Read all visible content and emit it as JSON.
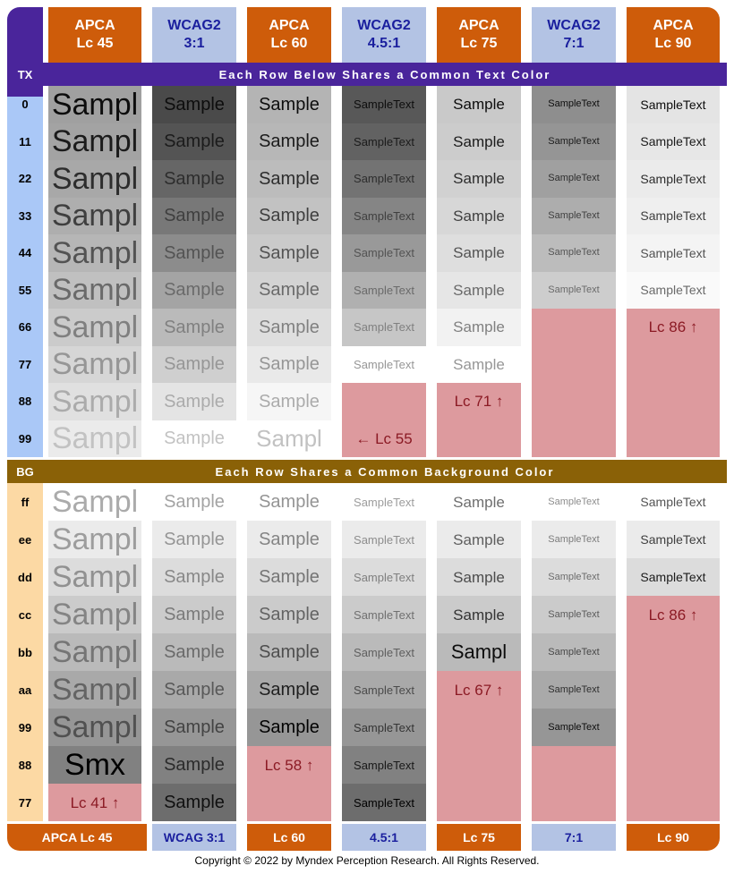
{
  "meta": {
    "copyright": "Copyright © 2022 by Myndex Perception Research. All Rights Reserved."
  },
  "colors": {
    "apca_chip": "#ce5c0a",
    "wcag_chip": "#b3c3e4",
    "apca_text": "#ffffff",
    "wcag_text": "#1a1f9e",
    "tx_bar": "#4a259b",
    "bg_bar": "#8a6107",
    "tx_label_cell": "#aac8f7",
    "bg_label_cell": "#fcd9a4",
    "fail_bg": "#dd9a9e",
    "fail_text": "#8b1a24"
  },
  "header": {
    "corner_tag": "TX",
    "columns": [
      {
        "std": "APCA",
        "level": "Lc 45",
        "kind": "apca"
      },
      {
        "std": "WCAG2",
        "level": "3:1",
        "kind": "wcag"
      },
      {
        "std": "APCA",
        "level": "Lc 60",
        "kind": "apca"
      },
      {
        "std": "WCAG2",
        "level": "4.5:1",
        "kind": "wcag"
      },
      {
        "std": "APCA",
        "level": "Lc 75",
        "kind": "apca"
      },
      {
        "std": "WCAG2",
        "level": "7:1",
        "kind": "wcag"
      },
      {
        "std": "APCA",
        "level": "Lc 90",
        "kind": "apca"
      }
    ]
  },
  "tx_section": {
    "tag": "TX",
    "title": "Each Row Below Shares a Common Text Color",
    "rows": [
      {
        "label": "0",
        "text": "#0d0d0d",
        "cells": [
          {
            "t": "Sampl",
            "bg": "#a0a0a0",
            "fs": 34
          },
          {
            "t": "Sample",
            "bg": "#4a4a4a",
            "fs": 20
          },
          {
            "t": "Sample",
            "bg": "#b4b4b4",
            "fs": 20
          },
          {
            "t": "SampleText",
            "bg": "#585858",
            "fs": 13
          },
          {
            "t": "Sample",
            "bg": "#c9c9c9",
            "fs": 17
          },
          {
            "t": "SampleText",
            "bg": "#8e8e8e",
            "fs": 11
          },
          {
            "t": "SampleText",
            "bg": "#e4e4e4",
            "fs": 14
          }
        ]
      },
      {
        "label": "11",
        "text": "#1b1b1b",
        "cells": [
          {
            "t": "Sampl",
            "bg": "#a3a3a3",
            "fs": 34
          },
          {
            "t": "Sample",
            "bg": "#545454",
            "fs": 20
          },
          {
            "t": "Sample",
            "bg": "#b7b7b7",
            "fs": 20
          },
          {
            "t": "SampleText",
            "bg": "#626262",
            "fs": 13
          },
          {
            "t": "Sample",
            "bg": "#cccccc",
            "fs": 17
          },
          {
            "t": "SampleText",
            "bg": "#959595",
            "fs": 11
          },
          {
            "t": "SampleText",
            "bg": "#e7e7e7",
            "fs": 14
          }
        ]
      },
      {
        "label": "22",
        "text": "#2d2d2d",
        "cells": [
          {
            "t": "Sampl",
            "bg": "#a8a8a8",
            "fs": 34
          },
          {
            "t": "Sample",
            "bg": "#666666",
            "fs": 20
          },
          {
            "t": "Sample",
            "bg": "#bcbcbc",
            "fs": 20
          },
          {
            "t": "SampleText",
            "bg": "#737373",
            "fs": 13
          },
          {
            "t": "Sample",
            "bg": "#d1d1d1",
            "fs": 17
          },
          {
            "t": "SampleText",
            "bg": "#a0a0a0",
            "fs": 11
          },
          {
            "t": "SampleText",
            "bg": "#ebebeb",
            "fs": 14
          }
        ]
      },
      {
        "label": "33",
        "text": "#3f3f3f",
        "cells": [
          {
            "t": "Sampl",
            "bg": "#aeaeae",
            "fs": 34
          },
          {
            "t": "Sample",
            "bg": "#787878",
            "fs": 20
          },
          {
            "t": "Sample",
            "bg": "#c2c2c2",
            "fs": 20
          },
          {
            "t": "SampleText",
            "bg": "#858585",
            "fs": 13
          },
          {
            "t": "Sample",
            "bg": "#d7d7d7",
            "fs": 17
          },
          {
            "t": "SampleText",
            "bg": "#adadad",
            "fs": 11
          },
          {
            "t": "SampleText",
            "bg": "#efefef",
            "fs": 14
          }
        ]
      },
      {
        "label": "44",
        "text": "#535353",
        "cells": [
          {
            "t": "Sampl",
            "bg": "#b6b6b6",
            "fs": 34
          },
          {
            "t": "Sample",
            "bg": "#8c8c8c",
            "fs": 20
          },
          {
            "t": "Sample",
            "bg": "#cacaca",
            "fs": 20
          },
          {
            "t": "SampleText",
            "bg": "#999999",
            "fs": 13
          },
          {
            "t": "Sample",
            "bg": "#dedede",
            "fs": 17
          },
          {
            "t": "SampleText",
            "bg": "#bcbcbc",
            "fs": 11
          },
          {
            "t": "SampleText",
            "bg": "#f4f4f4",
            "fs": 14
          }
        ]
      },
      {
        "label": "55",
        "text": "#6a6a6a",
        "cells": [
          {
            "t": "Sampl",
            "bg": "#c0c0c0",
            "fs": 34
          },
          {
            "t": "Sample",
            "bg": "#a4a4a4",
            "fs": 20
          },
          {
            "t": "Sample",
            "bg": "#d3d3d3",
            "fs": 20
          },
          {
            "t": "SampleText",
            "bg": "#b0b0b0",
            "fs": 13
          },
          {
            "t": "Sample",
            "bg": "#e6e6e6",
            "fs": 17
          },
          {
            "t": "SampleText",
            "bg": "#cdcdcd",
            "fs": 11
          },
          {
            "t": "SampleText",
            "bg": "#fafafa",
            "fs": 14
          }
        ]
      },
      {
        "label": "66",
        "text": "#808080",
        "cells": [
          {
            "t": "Sampl",
            "bg": "#cbcbcb",
            "fs": 34
          },
          {
            "t": "Sample",
            "bg": "#bababa",
            "fs": 20
          },
          {
            "t": "Sample",
            "bg": "#dedede",
            "fs": 20
          },
          {
            "t": "SampleText",
            "bg": "#c6c6c6",
            "fs": 13
          },
          {
            "t": "Sample",
            "bg": "#f2f2f2",
            "fs": 17
          },
          {
            "t": "",
            "bg": "#dd9a9e",
            "fs": 17,
            "fail": true
          },
          {
            "t": "Lc 86 ↑",
            "bg": "#dd9a9e",
            "fs": 17,
            "fail": true
          }
        ]
      },
      {
        "label": "77",
        "text": "#969696",
        "cells": [
          {
            "t": "Sampl",
            "bg": "#d6d6d6",
            "fs": 34
          },
          {
            "t": "Sample",
            "bg": "#cfcfcf",
            "fs": 20
          },
          {
            "t": "Sample",
            "bg": "#e9e9e9",
            "fs": 20
          },
          {
            "t": "SampleText",
            "bg": "#ffffff",
            "fs": 13
          },
          {
            "t": "Sample",
            "bg": "#ffffff",
            "fs": 17
          },
          {
            "t": "",
            "bg": "#dd9a9e",
            "fs": 17,
            "fail": true
          },
          {
            "t": "",
            "bg": "#dd9a9e",
            "fs": 17,
            "fail": true
          }
        ]
      },
      {
        "label": "88",
        "text": "#ababab",
        "cells": [
          {
            "t": "Sampl",
            "bg": "#e0e0e0",
            "fs": 34
          },
          {
            "t": "Sample",
            "bg": "#e4e4e4",
            "fs": 20
          },
          {
            "t": "Sample",
            "bg": "#f6f6f6",
            "fs": 20
          },
          {
            "t": "",
            "bg": "#dd9a9e",
            "fs": 17,
            "fail": true
          },
          {
            "t": "Lc 71 ↑",
            "bg": "#dd9a9e",
            "fs": 17,
            "fail": true
          },
          {
            "t": "",
            "bg": "#dd9a9e",
            "fs": 17,
            "fail": true
          },
          {
            "t": "",
            "bg": "#dd9a9e",
            "fs": 17,
            "fail": true
          }
        ]
      },
      {
        "label": "99",
        "text": "#c2c2c2",
        "cells": [
          {
            "t": "Sampl",
            "bg": "#ebebeb",
            "fs": 34
          },
          {
            "t": "Sample",
            "bg": "#ffffff",
            "fs": 20
          },
          {
            "t": "Sampl",
            "bg": "#ffffff",
            "fs": 26
          },
          {
            "t": "← Lc 55",
            "bg": "#dd9a9e",
            "fs": 17,
            "fail": true
          },
          {
            "t": "",
            "bg": "#dd9a9e",
            "fs": 17,
            "fail": true
          },
          {
            "t": "",
            "bg": "#dd9a9e",
            "fs": 17,
            "fail": true
          },
          {
            "t": "",
            "bg": "#dd9a9e",
            "fs": 17,
            "fail": true
          }
        ]
      }
    ]
  },
  "bg_section": {
    "tag": "BG",
    "title": "Each Row Shares a Common Background Color",
    "rows": [
      {
        "label": "ff",
        "bg": "#ffffff",
        "cells": [
          {
            "t": "Sampl",
            "fg": "#ababab",
            "fs": 34
          },
          {
            "t": "Sample",
            "fg": "#a3a3a3",
            "fs": 20
          },
          {
            "t": "Sample",
            "fg": "#949494",
            "fs": 20
          },
          {
            "t": "SampleText",
            "fg": "#9c9c9c",
            "fs": 13
          },
          {
            "t": "Sample",
            "fg": "#6e6e6e",
            "fs": 17
          },
          {
            "t": "SampleText",
            "fg": "#8c8c8c",
            "fs": 11
          },
          {
            "t": "SampleText",
            "fg": "#545454",
            "fs": 14
          }
        ]
      },
      {
        "label": "ee",
        "bg": "#ebebeb",
        "cells": [
          {
            "t": "Sampl",
            "fg": "#9d9d9d",
            "fs": 34
          },
          {
            "t": "Sample",
            "fg": "#959595",
            "fs": 20
          },
          {
            "t": "Sample",
            "fg": "#848484",
            "fs": 20
          },
          {
            "t": "SampleText",
            "fg": "#8d8d8d",
            "fs": 13
          },
          {
            "t": "Sample",
            "fg": "#5e5e5e",
            "fs": 17
          },
          {
            "t": "SampleText",
            "fg": "#7c7c7c",
            "fs": 11
          },
          {
            "t": "SampleText",
            "fg": "#404040",
            "fs": 14
          }
        ]
      },
      {
        "label": "dd",
        "bg": "#dcdcdc",
        "cells": [
          {
            "t": "Sampl",
            "fg": "#919191",
            "fs": 34
          },
          {
            "t": "Sample",
            "fg": "#888888",
            "fs": 20
          },
          {
            "t": "Sample",
            "fg": "#757575",
            "fs": 20
          },
          {
            "t": "SampleText",
            "fg": "#7f7f7f",
            "fs": 13
          },
          {
            "t": "Sample",
            "fg": "#4c4c4c",
            "fs": 17
          },
          {
            "t": "SampleText",
            "fg": "#6c6c6c",
            "fs": 11
          },
          {
            "t": "SampleText",
            "fg": "#1c1c1c",
            "fs": 14
          }
        ]
      },
      {
        "label": "cc",
        "bg": "#cbcbcb",
        "cells": [
          {
            "t": "Sampl",
            "fg": "#848484",
            "fs": 34
          },
          {
            "t": "Sample",
            "fg": "#7a7a7a",
            "fs": 20
          },
          {
            "t": "Sample",
            "fg": "#636363",
            "fs": 20
          },
          {
            "t": "SampleText",
            "fg": "#707070",
            "fs": 13
          },
          {
            "t": "Sample",
            "fg": "#343434",
            "fs": 17
          },
          {
            "t": "SampleText",
            "fg": "#5b5b5b",
            "fs": 11
          },
          {
            "t": "Lc 86 ↑",
            "fg": "#8b1a24",
            "fs": 17,
            "fail": true
          }
        ]
      },
      {
        "label": "bb",
        "bg": "#bababa",
        "cells": [
          {
            "t": "Sampl",
            "fg": "#757575",
            "fs": 34
          },
          {
            "t": "Sample",
            "fg": "#6a6a6a",
            "fs": 20
          },
          {
            "t": "Sample",
            "fg": "#4e4e4e",
            "fs": 20
          },
          {
            "t": "SampleText",
            "fg": "#5f5f5f",
            "fs": 13
          },
          {
            "t": "Sampl",
            "fg": "#0d0d0d",
            "fs": 22
          },
          {
            "t": "SampleText",
            "fg": "#474747",
            "fs": 11
          },
          {
            "t": "",
            "fg": "#8b1a24",
            "fs": 17,
            "fail": true
          }
        ]
      },
      {
        "label": "aa",
        "bg": "#a9a9a9",
        "cells": [
          {
            "t": "Sampl",
            "fg": "#646464",
            "fs": 34
          },
          {
            "t": "Sample",
            "fg": "#585858",
            "fs": 20
          },
          {
            "t": "Sample",
            "fg": "#1f1f1f",
            "fs": 20
          },
          {
            "t": "SampleText",
            "fg": "#4b4b4b",
            "fs": 13
          },
          {
            "t": "Lc 67 ↑",
            "fg": "#8b1a24",
            "fs": 17,
            "fail": true
          },
          {
            "t": "SampleText",
            "fg": "#2e2e2e",
            "fs": 11
          },
          {
            "t": "",
            "fg": "#8b1a24",
            "fs": 17,
            "fail": true
          }
        ]
      },
      {
        "label": "99",
        "bg": "#969696",
        "cells": [
          {
            "t": "Sampl",
            "fg": "#515151",
            "fs": 34
          },
          {
            "t": "Sample",
            "fg": "#434343",
            "fs": 20
          },
          {
            "t": "Sample",
            "fg": "#020202",
            "fs": 20
          },
          {
            "t": "SampleText",
            "fg": "#343434",
            "fs": 13
          },
          {
            "t": "",
            "fg": "#8b1a24",
            "fs": 17,
            "fail": true
          },
          {
            "t": "SampleText",
            "fg": "#0d0d0d",
            "fs": 11
          },
          {
            "t": "",
            "fg": "#8b1a24",
            "fs": 17,
            "fail": true
          }
        ]
      },
      {
        "label": "88",
        "bg": "#818181",
        "cells": [
          {
            "t": "Smx",
            "fg": "#000000",
            "fs": 34
          },
          {
            "t": "Sample",
            "fg": "#2b2b2b",
            "fs": 20
          },
          {
            "t": "Lc 58 ↑",
            "fg": "#8b1a24",
            "fs": 17,
            "fail": true
          },
          {
            "t": "SampleText",
            "fg": "#181818",
            "fs": 13
          },
          {
            "t": "",
            "fg": "#8b1a24",
            "fs": 17,
            "fail": true
          },
          {
            "t": "",
            "fg": "#8b1a24",
            "fs": 17,
            "fail": true
          },
          {
            "t": "",
            "fg": "#8b1a24",
            "fs": 17,
            "fail": true
          }
        ]
      },
      {
        "label": "77",
        "bg": "#6d6d6d",
        "cells": [
          {
            "t": "Lc 41 ↑",
            "fg": "#8b1a24",
            "fs": 17,
            "fail": true
          },
          {
            "t": "Sample",
            "fg": "#101010",
            "fs": 20
          },
          {
            "t": "",
            "fg": "#8b1a24",
            "fs": 17,
            "fail": true
          },
          {
            "t": "SampleText",
            "fg": "#000000",
            "fs": 13
          },
          {
            "t": "",
            "fg": "#8b1a24",
            "fs": 17,
            "fail": true
          },
          {
            "t": "",
            "fg": "#8b1a24",
            "fs": 17,
            "fail": true
          },
          {
            "t": "",
            "fg": "#8b1a24",
            "fs": 17,
            "fail": true
          }
        ]
      }
    ]
  },
  "footer": {
    "chips": [
      {
        "label": "APCA Lc 45",
        "kind": "apca"
      },
      {
        "label": "WCAG 3:1",
        "kind": "wcag"
      },
      {
        "label": "Lc 60",
        "kind": "apca"
      },
      {
        "label": "4.5:1",
        "kind": "wcag"
      },
      {
        "label": "Lc 75",
        "kind": "apca"
      },
      {
        "label": "7:1",
        "kind": "wcag"
      },
      {
        "label": "Lc 90",
        "kind": "apca"
      }
    ]
  }
}
